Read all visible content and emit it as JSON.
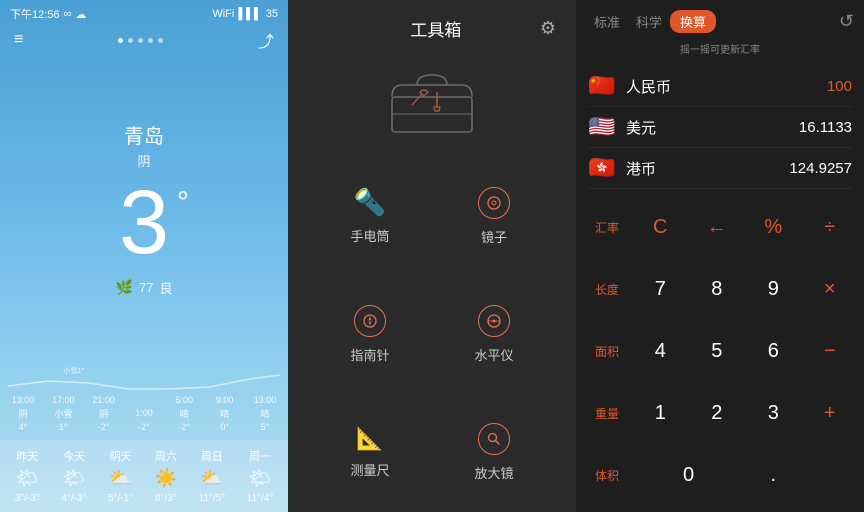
{
  "weather": {
    "status_bar": {
      "time": "下午12:56",
      "battery": "35"
    },
    "city": "青岛",
    "condition": "阴",
    "temperature": "3",
    "aqi_value": "77",
    "aqi_label": "良",
    "hourly": [
      {
        "time": "13:00",
        "desc": "阴",
        "temp": "4°"
      },
      {
        "time": "17:00",
        "desc": "小雪",
        "temp": "1°"
      },
      {
        "time": "21:00",
        "desc": "阴",
        "temp": "-2°"
      },
      {
        "time": "1:00",
        "desc": "",
        "temp": "-2°"
      },
      {
        "time": "5:00",
        "desc": "晴",
        "temp": "-2°"
      },
      {
        "time": "9:00",
        "desc": "晴",
        "temp": "0°"
      },
      {
        "time": "13:00",
        "desc": "晴",
        "temp": "5°"
      }
    ],
    "weekly": [
      {
        "day": "昨天",
        "icon": "🌤",
        "temp": "3°/-3°"
      },
      {
        "day": "今天",
        "icon": "🌤",
        "temp": "4°/-3°"
      },
      {
        "day": "明天",
        "icon": "⛅",
        "temp": "5°/-1°"
      },
      {
        "day": "周六",
        "icon": "☀️",
        "temp": "8°/3°"
      },
      {
        "day": "周日",
        "icon": "⛅",
        "temp": "11°/5°"
      },
      {
        "day": "周一",
        "icon": "🌤",
        "temp": "11°/4°"
      }
    ]
  },
  "toolbox": {
    "title": "工具箱",
    "tools": [
      {
        "id": "flashlight",
        "label": "手电筒",
        "icon_type": "flashlight"
      },
      {
        "id": "mirror",
        "label": "镜子",
        "icon_type": "circle"
      },
      {
        "id": "compass",
        "label": "指南针",
        "icon_type": "compass"
      },
      {
        "id": "level",
        "label": "水平仪",
        "icon_type": "level"
      },
      {
        "id": "ruler",
        "label": "测量尺",
        "icon_type": "ruler"
      },
      {
        "id": "magnifier",
        "label": "放大镜",
        "icon_type": "search"
      }
    ]
  },
  "calculator": {
    "tabs": [
      {
        "label": "标准",
        "active": false
      },
      {
        "label": "科学",
        "active": false
      },
      {
        "label": "换算",
        "active": true
      }
    ],
    "hint": "摇一摇可更新汇率",
    "currencies": [
      {
        "flag": "🇨🇳",
        "name": "人民币",
        "value": "100",
        "active": true
      },
      {
        "flag": "🇺🇸",
        "name": "美元",
        "value": "16.1133",
        "active": false
      },
      {
        "flag": "🇭🇰",
        "name": "港币",
        "value": "124.9257",
        "active": false
      }
    ],
    "row_labels": [
      "汇率",
      "长度",
      "面积",
      "重量",
      "体积"
    ],
    "keys_row1": [
      "C",
      "←",
      "%",
      "÷"
    ],
    "keys_row2": [
      "7",
      "8",
      "9",
      "×"
    ],
    "keys_row3": [
      "4",
      "5",
      "6",
      "−"
    ],
    "keys_row4": [
      "1",
      "2",
      "3",
      "+"
    ],
    "keys_row5": [
      "0",
      "",
      ".",
      ""
    ]
  }
}
